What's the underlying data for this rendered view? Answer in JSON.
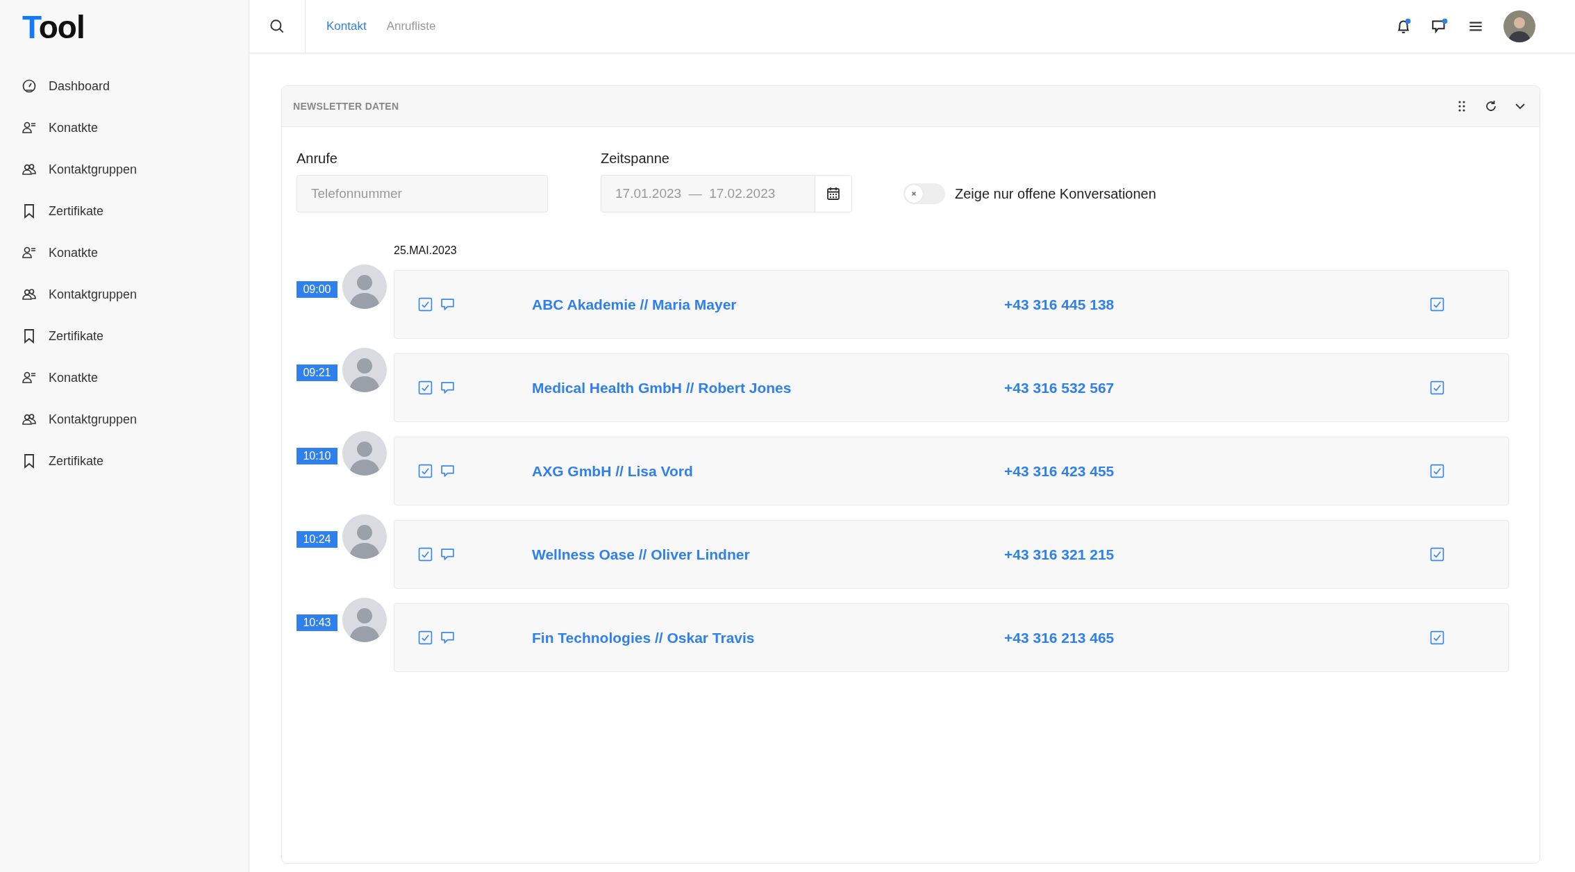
{
  "logo": "Tool",
  "sidebar": {
    "items": [
      {
        "label": "Dashboard",
        "kind": "dashboard"
      },
      {
        "label": "Konatkte",
        "kind": "contacts"
      },
      {
        "label": "Kontaktgruppen",
        "kind": "groups"
      },
      {
        "label": "Zertifikate",
        "kind": "bookmark"
      },
      {
        "label": "Konatkte",
        "kind": "contacts"
      },
      {
        "label": "Kontaktgruppen",
        "kind": "groups"
      },
      {
        "label": "Zertifikate",
        "kind": "bookmark"
      },
      {
        "label": "Konatkte",
        "kind": "contacts"
      },
      {
        "label": "Kontaktgruppen",
        "kind": "groups"
      },
      {
        "label": "Zertifikate",
        "kind": "bookmark"
      }
    ]
  },
  "header": {
    "tabs": [
      {
        "label": "Kontakt",
        "selected": true
      },
      {
        "label": "Anrufliste",
        "selected": false
      }
    ],
    "notifications": {
      "unread": true
    },
    "messages": {
      "unread": true
    }
  },
  "card": {
    "title": "NEWSLETTER DATEN",
    "filters": {
      "calls_label": "Anrufe",
      "phone_placeholder": "Telefonnummer",
      "period_label": "Zeitspanne",
      "date_from": "17.01.2023",
      "date_separator": "—",
      "date_to": "17.02.2023",
      "toggle": {
        "on": false,
        "label": "Zeige nur offene Konversationen"
      }
    },
    "date": "25.MAI.2023",
    "calls": [
      {
        "time": "09:00",
        "name": "ABC Akademie // Maria Mayer",
        "phone": "+43 316 445 138",
        "checked": true,
        "done": true
      },
      {
        "time": "09:21",
        "name": "Medical Health GmbH // Robert Jones",
        "phone": "+43 316 532 567",
        "checked": true,
        "done": true
      },
      {
        "time": "10:10",
        "name": "AXG GmbH // Lisa Vord",
        "phone": "+43 316 423 455",
        "checked": true,
        "done": true
      },
      {
        "time": "10:24",
        "name": "Wellness Oase // Oliver Lindner",
        "phone": "+43 316 321 215",
        "checked": true,
        "done": true
      },
      {
        "time": "10:43",
        "name": "Fin Technologies // Oskar Travis",
        "phone": "+43 316 213 465",
        "checked": true,
        "done": true
      }
    ]
  }
}
